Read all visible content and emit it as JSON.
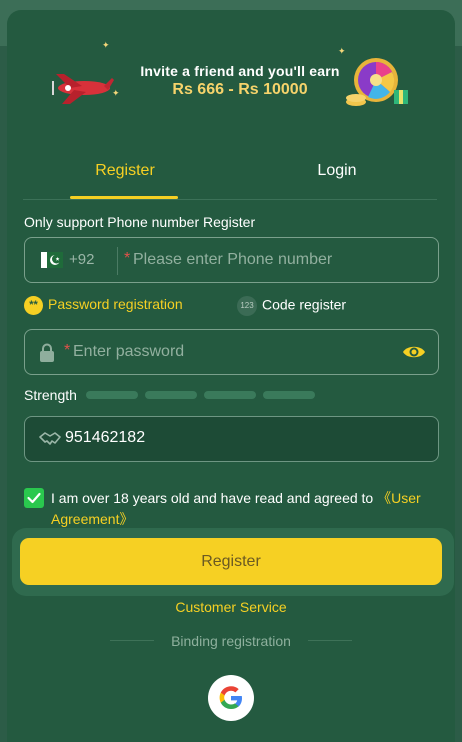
{
  "banner": {
    "line1": "Invite a friend and you'll earn",
    "line2": "Rs 666 - Rs 10000"
  },
  "tabs": [
    {
      "label": "Register",
      "active": true
    },
    {
      "label": "Login",
      "active": false
    }
  ],
  "support_label": "Only support Phone number Register",
  "phone": {
    "country_code": "+92",
    "placeholder": "Please enter Phone number",
    "required_mark": "*",
    "flag_icon": "pakistan-flag-icon"
  },
  "modes": {
    "password_label": "Password registration",
    "password_dot": "**",
    "code_label": "Code register",
    "code_badge": "123"
  },
  "password": {
    "placeholder": "Enter password",
    "required_mark": "*"
  },
  "strength": {
    "label": "Strength",
    "segments": 4,
    "filled": 0
  },
  "code": {
    "value": "951462182"
  },
  "agreement": {
    "checked": true,
    "text": "I am over 18 years old and have read and agreed to ",
    "link": "《User Agreement》"
  },
  "register_button": "Register",
  "customer_service": "Customer Service",
  "binding_label": "Binding registration",
  "colors": {
    "background": "#245a40",
    "accent": "#f6d023",
    "checkbox": "#2ac84e",
    "required": "#e0524a"
  }
}
